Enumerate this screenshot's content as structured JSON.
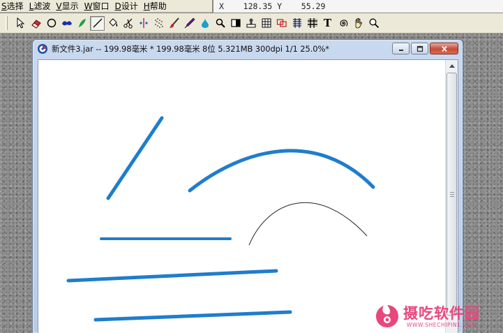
{
  "menu": {
    "items": [
      {
        "key": "S",
        "label": "选择"
      },
      {
        "key": "L",
        "label": "滤波"
      },
      {
        "key": "V",
        "label": "显示"
      },
      {
        "key": "W",
        "label": "窗口"
      },
      {
        "key": "D",
        "label": "设计"
      },
      {
        "key": "H",
        "label": "帮助"
      }
    ]
  },
  "status": {
    "x_label": "X",
    "x_value": "128.35",
    "y_label": "Y",
    "y_value": "55.29"
  },
  "toolbar": {
    "tools": [
      "pointer-icon",
      "eraser-icon",
      "circle-icon",
      "blob-brush-icon",
      "leaf-pen-icon",
      "line-icon",
      "bucket-icon",
      "scissors-icon",
      "pins-icon",
      "spray-icon",
      "brush-icon",
      "pen-tip-icon",
      "water-drop-icon",
      "magnifier-icon",
      "rect-fill-icon",
      "stamp-icon",
      "grid-square-icon",
      "overlap-icon",
      "weave-icon",
      "mesh-icon",
      "text-icon",
      "spiral-icon",
      "hand-icon",
      "zoom-icon"
    ],
    "active_tool": "line-icon",
    "text_tool_glyph": "T"
  },
  "document": {
    "title": "新文件3.jar -- 199.98毫米 * 199.98毫米 8位   5.321MB 300dpi 1/1  25.0%*",
    "stroke_color": "#1f7dcc",
    "thin_stroke_color": "#222222"
  },
  "watermark": {
    "main": "摄吃软件园",
    "sub": "WWW.SHECHIPIN1.COM",
    "color": "#e8477e"
  }
}
